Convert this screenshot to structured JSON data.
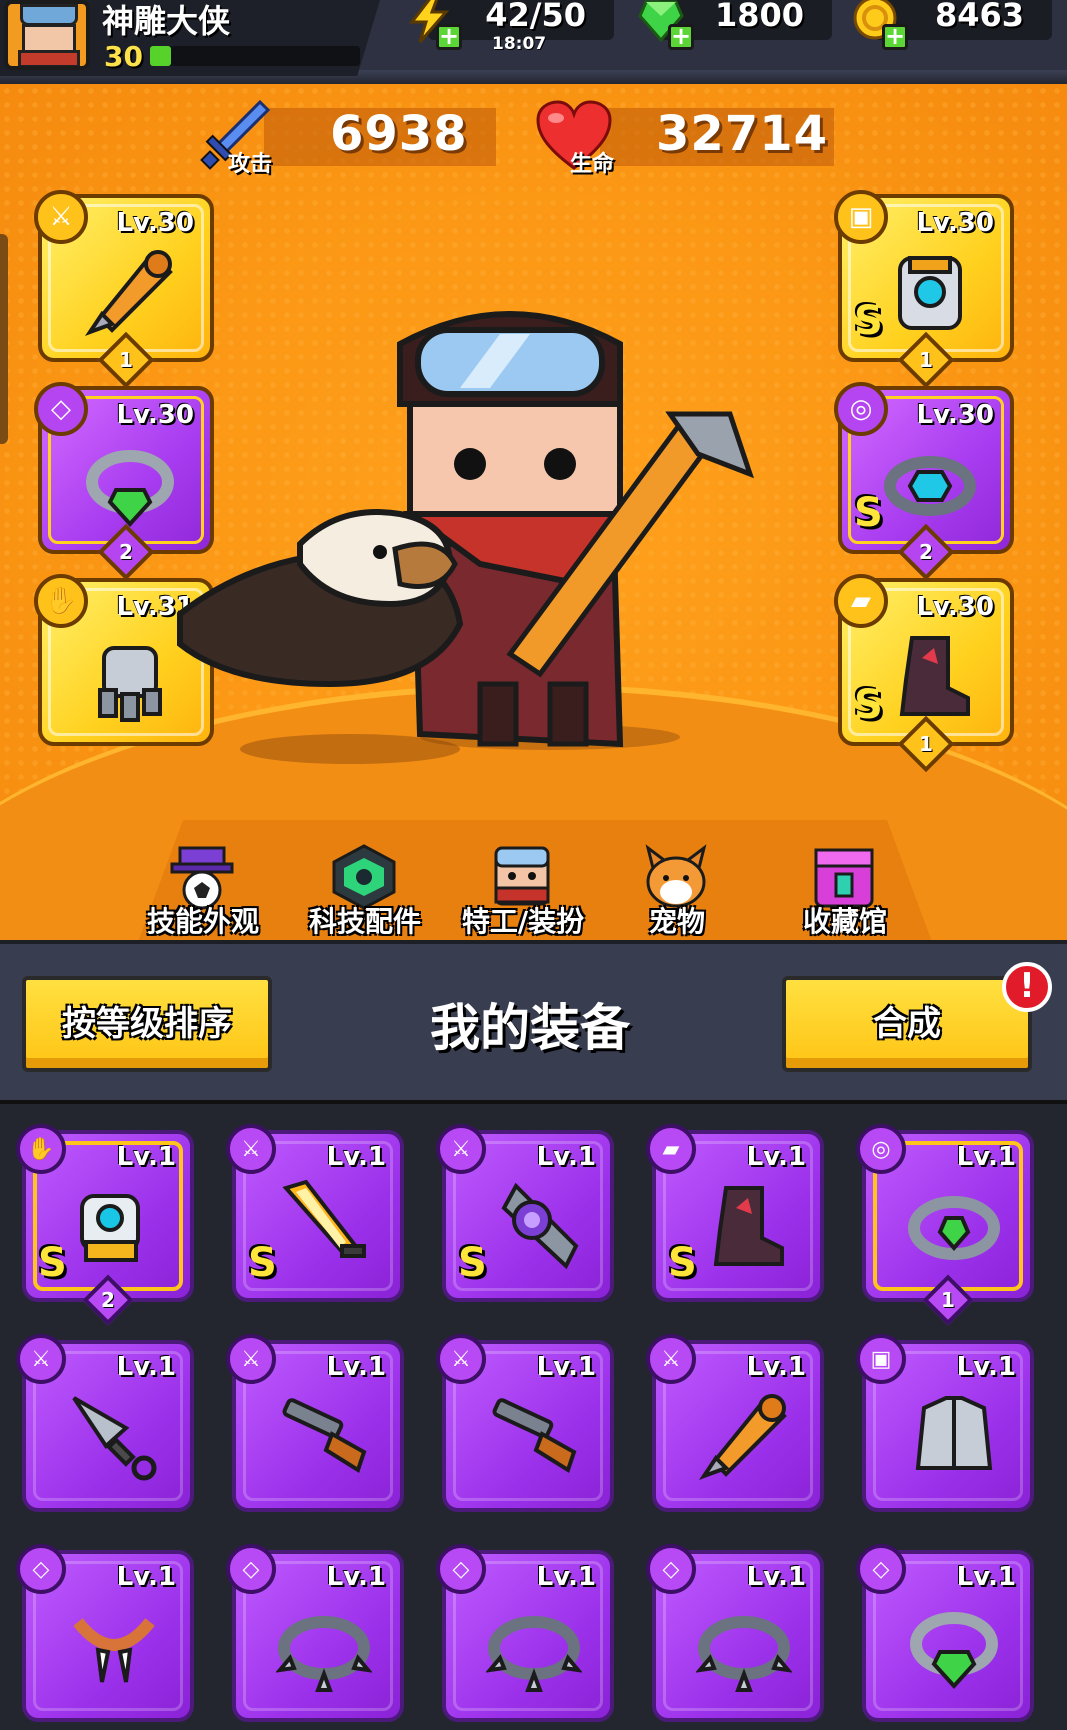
{
  "player": {
    "name": "神雕大侠",
    "level": "30",
    "xp_fraction": 0.1
  },
  "resources": {
    "energy": {
      "value": "42/50",
      "timer": "18:07",
      "icon": "lightning-icon"
    },
    "gems": {
      "value": "1800",
      "icon": "green-gem-icon"
    },
    "coins": {
      "value": "8463",
      "icon": "gold-coin-icon"
    }
  },
  "stats": {
    "attack": {
      "label": "攻击",
      "value": "6938",
      "icon": "sword-icon"
    },
    "health": {
      "label": "生命",
      "value": "32714",
      "icon": "heart-icon"
    }
  },
  "equipped": {
    "left": [
      {
        "type_icon": "weapon-icon",
        "lv": "Lv.30",
        "count": "1",
        "rank": "",
        "art": "drill-spear",
        "rarity": "gold"
      },
      {
        "type_icon": "necklace-icon",
        "lv": "Lv.30",
        "count": "2",
        "rank": "",
        "art": "green-gem-ring",
        "rarity": "purple"
      },
      {
        "type_icon": "glove-icon",
        "lv": "Lv.31",
        "count": "",
        "rank": "",
        "art": "steel-gauntlet",
        "rarity": "gold"
      }
    ],
    "right": [
      {
        "type_icon": "armor-icon",
        "lv": "Lv.30",
        "count": "1",
        "rank": "S",
        "art": "mech-armor",
        "rarity": "gold"
      },
      {
        "type_icon": "belt-icon",
        "lv": "Lv.30",
        "count": "2",
        "rank": "S",
        "art": "mech-belt",
        "rarity": "purple"
      },
      {
        "type_icon": "boots-icon",
        "lv": "Lv.30",
        "count": "1",
        "rank": "S",
        "art": "spiked-boots",
        "rarity": "gold"
      }
    ]
  },
  "hero_tabs": [
    {
      "label": "技能外观",
      "icon": "hat-ball-icon"
    },
    {
      "label": "科技配件",
      "icon": "hex-chip-icon"
    },
    {
      "label": "特工/装扮",
      "icon": "agent-icon"
    },
    {
      "label": "宠物",
      "icon": "shiba-icon"
    },
    {
      "label": "收藏馆",
      "icon": "chest-icon"
    }
  ],
  "equipment": {
    "sort_label": "按等级排序",
    "title": "我的装备",
    "merge_label": "合成",
    "alert": "!"
  },
  "inventory": [
    {
      "type_icon": "glove-icon",
      "lv": "Lv.1",
      "rank": "S",
      "count": "2",
      "framed": true,
      "art": "cyber-glove"
    },
    {
      "type_icon": "weapon-icon",
      "lv": "Lv.1",
      "rank": "S",
      "count": "",
      "framed": false,
      "art": "flame-sword"
    },
    {
      "type_icon": "weapon-icon",
      "lv": "Lv.1",
      "rank": "S",
      "count": "",
      "framed": false,
      "art": "orb-blade"
    },
    {
      "type_icon": "boots-icon",
      "lv": "Lv.1",
      "rank": "S",
      "count": "",
      "framed": false,
      "art": "spiked-boots"
    },
    {
      "type_icon": "belt-icon",
      "lv": "Lv.1",
      "rank": "",
      "count": "1",
      "framed": true,
      "art": "gem-belt"
    },
    {
      "type_icon": "weapon-icon",
      "lv": "Lv.1",
      "rank": "",
      "count": "",
      "framed": false,
      "art": "kunai"
    },
    {
      "type_icon": "weapon-icon",
      "lv": "Lv.1",
      "rank": "",
      "count": "",
      "framed": false,
      "art": "shotgun"
    },
    {
      "type_icon": "weapon-icon",
      "lv": "Lv.1",
      "rank": "",
      "count": "",
      "framed": false,
      "art": "shotgun"
    },
    {
      "type_icon": "weapon-icon",
      "lv": "Lv.1",
      "rank": "",
      "count": "",
      "framed": false,
      "art": "drill-spear"
    },
    {
      "type_icon": "armor-icon",
      "lv": "Lv.1",
      "rank": "",
      "count": "",
      "framed": false,
      "art": "steel-armor"
    },
    {
      "type_icon": "necklace-icon",
      "lv": "Lv.1",
      "rank": "",
      "count": "",
      "framed": false,
      "art": "fang-necklace"
    },
    {
      "type_icon": "necklace-icon",
      "lv": "Lv.1",
      "rank": "",
      "count": "",
      "framed": false,
      "art": "spiked-collar"
    },
    {
      "type_icon": "necklace-icon",
      "lv": "Lv.1",
      "rank": "",
      "count": "",
      "framed": false,
      "art": "spiked-collar"
    },
    {
      "type_icon": "necklace-icon",
      "lv": "Lv.1",
      "rank": "",
      "count": "",
      "framed": false,
      "art": "spiked-collar"
    },
    {
      "type_icon": "necklace-icon",
      "lv": "Lv.1",
      "rank": "",
      "count": "",
      "framed": false,
      "art": "green-gem-ring"
    }
  ],
  "colors": {
    "gold_card": "#ffd11f",
    "purple_card": "#a83cf0",
    "hero_bg": "#fb9714",
    "alert": "#e21b2a"
  }
}
